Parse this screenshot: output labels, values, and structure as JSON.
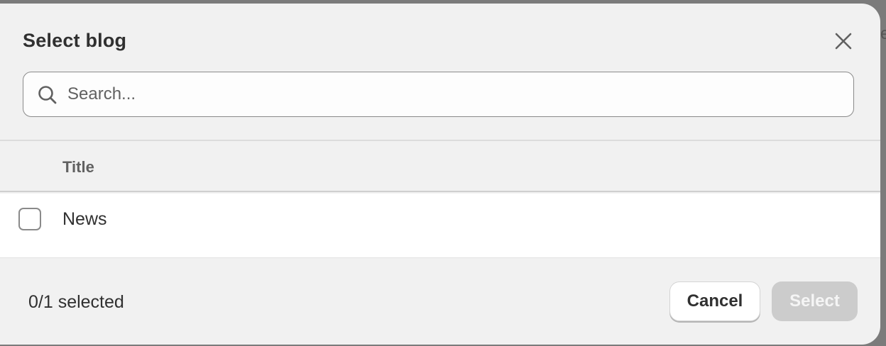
{
  "background": {
    "partial_text": "e"
  },
  "modal": {
    "title": "Select blog",
    "close_icon": "close-x-icon",
    "search": {
      "icon": "search-icon",
      "placeholder": "Search...",
      "value": ""
    },
    "table": {
      "columns": [
        "Title"
      ],
      "rows": [
        {
          "title": "News",
          "checked": false
        }
      ]
    },
    "footer": {
      "selected_count": "0/1 selected",
      "cancel_label": "Cancel",
      "select_label": "Select",
      "select_disabled": true
    }
  },
  "colors": {
    "modal_bg": "#f1f1f1",
    "primary_disabled": "#cccccc",
    "text": "#303030",
    "muted_text": "#616161"
  }
}
